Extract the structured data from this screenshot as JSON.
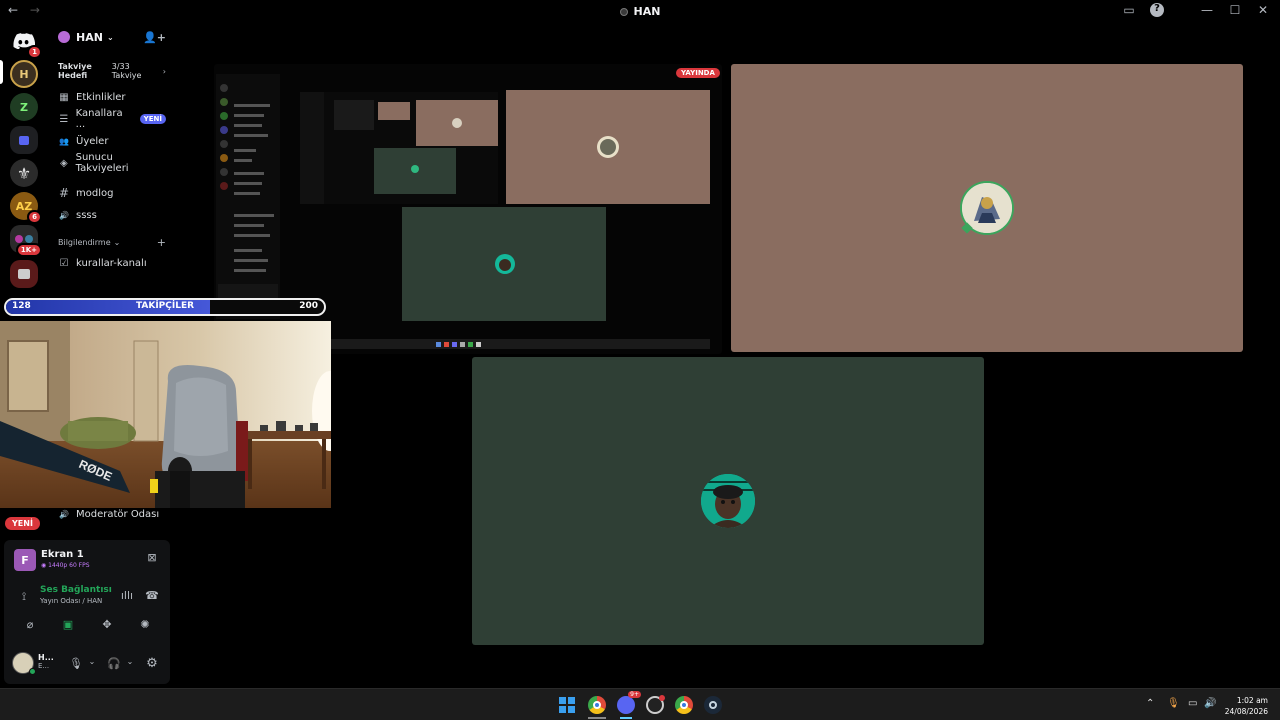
{
  "window": {
    "title": "HAN",
    "nav_back": "←",
    "nav_forward": "→",
    "controls": {
      "inbox": "▭",
      "help": "?",
      "minimize": "—",
      "maximize": "☐",
      "close": "✕"
    }
  },
  "servers": [
    {
      "label": "",
      "icon": "discord-home-icon",
      "badge": "1",
      "color": "#5865f2"
    },
    {
      "label": "H",
      "icon": "server-h-icon",
      "badge": "",
      "color": "#3b2f1f"
    },
    {
      "label": "Z",
      "icon": "server-z-icon",
      "badge": "",
      "color": "#1f3d23"
    },
    {
      "label": "",
      "icon": "folder-icon",
      "badge": "",
      "color": "#1e1f22"
    },
    {
      "label": "⚜",
      "icon": "server-fleur-icon",
      "badge": "",
      "color": "#2b2b2b"
    },
    {
      "label": "AZ",
      "icon": "server-az-icon",
      "badge": "6",
      "color": "#8a5a12"
    },
    {
      "label": "",
      "icon": "server-folder-icon",
      "badge": "1K+",
      "color": "#2a2a2a"
    },
    {
      "label": "",
      "icon": "server-red-icon",
      "badge": "",
      "color": "#5a1a1a"
    }
  ],
  "guild": {
    "name": "HAN",
    "boost_label": "Takviye",
    "boost_label2": "Hedefi",
    "boost_count": "3/33",
    "boost_unit": "Takviye"
  },
  "channels": [
    {
      "icon": "calendar-icon",
      "glyph": "▦",
      "label": "Etkinlikler",
      "badge": ""
    },
    {
      "icon": "channels-icon",
      "glyph": "☰",
      "label": "Kanallara ...",
      "badge": "YENİ"
    },
    {
      "icon": "members-icon",
      "glyph": "👥",
      "label": "Üyeler",
      "badge": ""
    },
    {
      "icon": "boost-icon",
      "glyph": "◈",
      "label": "Sunucu Takviyeleri",
      "badge": ""
    }
  ],
  "text_channels": [
    {
      "icon": "hash-icon",
      "glyph": "#",
      "label": "modlog"
    },
    {
      "icon": "speaker-icon",
      "glyph": "🔊",
      "label": "ssss"
    }
  ],
  "category": {
    "label": "Bilgilendirme",
    "plus": "+"
  },
  "category_channels": [
    {
      "icon": "rules-icon",
      "glyph": "☑",
      "label": "kurallar-kanalı"
    }
  ],
  "followers_bar": {
    "label": "TAKİPÇİLER",
    "current": "128",
    "goal": "200",
    "progress": 0.64,
    "color": "#3346c8"
  },
  "moderator_room": {
    "glyph": "🔊",
    "label": "Moderatör Odası"
  },
  "new_pill": "YENİ",
  "stream_panel": {
    "screen_title": "Ekran 1",
    "screen_meta": "1440p 60 FPS",
    "voice_status": "Ses Bağlantısı K",
    "voice_location": "Yayın Odası / HAN",
    "user_name": "H...",
    "user_status": "E..."
  },
  "live_badge": "YAYINDA",
  "colors": {
    "tile_brown": "#8a6d60",
    "tile_green": "#2f3f35",
    "live": "#da373c",
    "accent": "#5865f2"
  },
  "taskbar": {
    "apps": [
      "windows-start-icon",
      "chrome-icon",
      "discord-icon",
      "obs-icon",
      "chrome-profile-icon",
      "steam-icon"
    ],
    "discord_badge": "9+",
    "time": "1:02 am",
    "date": "24/08/2026"
  }
}
